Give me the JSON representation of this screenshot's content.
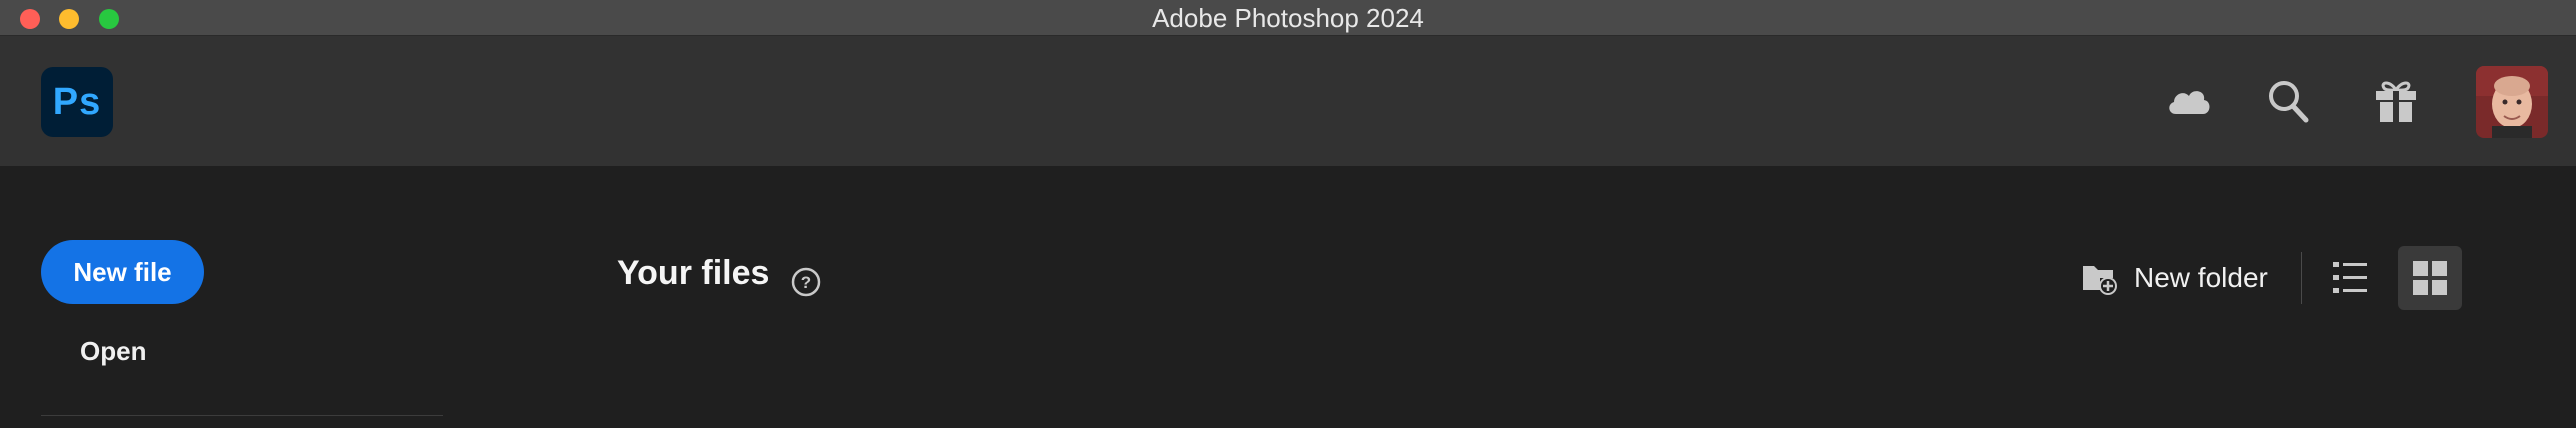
{
  "window": {
    "title": "Adobe Photoshop 2024"
  },
  "header": {
    "logo_text": "Ps",
    "icons": [
      "cloud-icon",
      "search-icon",
      "gift-icon"
    ],
    "avatar": "user-avatar"
  },
  "sidebar": {
    "new_file_label": "New file",
    "open_label": "Open"
  },
  "main": {
    "title": "Your files",
    "new_folder_label": "New folder",
    "view_modes": [
      "list",
      "grid"
    ],
    "active_view": "grid"
  },
  "colors": {
    "accent": "#1473e6",
    "ps_logo_bg": "#001e36",
    "ps_logo_fg": "#31a8ff"
  }
}
